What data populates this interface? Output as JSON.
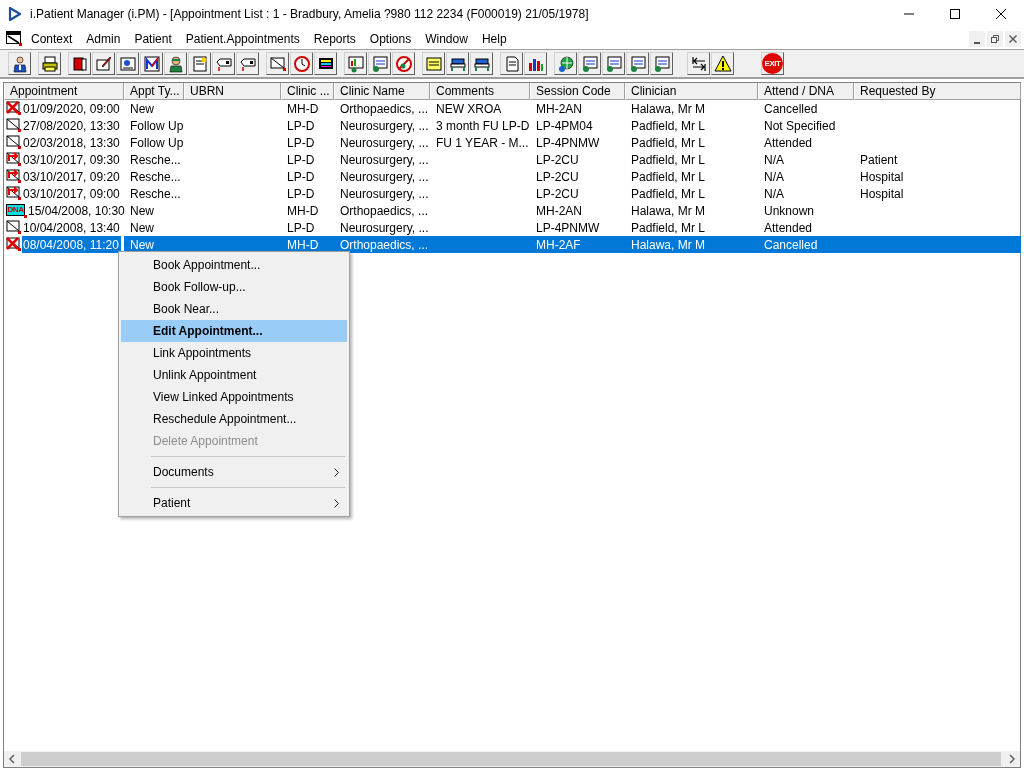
{
  "window": {
    "title": "i.Patient Manager (i.PM) - [Appointment List : 1 - Bradbury, Amelia ?980 112 2234 (F000019) 21/05/1978]"
  },
  "menu_bar": [
    "Context",
    "Admin",
    "Patient",
    "Patient.Appointments",
    "Reports",
    "Options",
    "Window",
    "Help"
  ],
  "toolbar": {
    "exit_label": "EXIT"
  },
  "table": {
    "columns": [
      "Appointment",
      "Appt Ty...",
      "UBRN",
      "Clinic ...",
      "Clinic Name",
      "Comments",
      "Session Code",
      "Clinician",
      "Attend / DNA",
      "Requested By"
    ],
    "rows": [
      {
        "kind": "cancelled",
        "selected": false,
        "cells": [
          "01/09/2020, 09:00",
          "New",
          "",
          "MH-D",
          "Orthopaedics, ...",
          "NEW XROA",
          "MH-2AN",
          "Halawa, Mr M",
          "Cancelled",
          ""
        ]
      },
      {
        "kind": "booked",
        "selected": false,
        "cells": [
          "27/08/2020, 13:30",
          "Follow Up",
          "",
          "LP-D",
          "Neurosurgery, ...",
          "3 month FU LP-D",
          "LP-4PM04",
          "Padfield, Mr L",
          "Not Specified",
          ""
        ]
      },
      {
        "kind": "booked",
        "selected": false,
        "cells": [
          "02/03/2018, 13:30",
          "Follow Up",
          "",
          "LP-D",
          "Neurosurgery, ...",
          "FU 1 YEAR - M...",
          "LP-4PNMW",
          "Padfield, Mr L",
          "Attended",
          ""
        ]
      },
      {
        "kind": "rescheduled",
        "selected": false,
        "cells": [
          "03/10/2017, 09:30",
          "Resche...",
          "",
          "LP-D",
          "Neurosurgery, ...",
          "",
          "LP-2CU",
          "Padfield, Mr L",
          "N/A",
          "Patient"
        ]
      },
      {
        "kind": "rescheduled",
        "selected": false,
        "cells": [
          "03/10/2017, 09:20",
          "Resche...",
          "",
          "LP-D",
          "Neurosurgery, ...",
          "",
          "LP-2CU",
          "Padfield, Mr L",
          "N/A",
          "Hospital"
        ]
      },
      {
        "kind": "rescheduled",
        "selected": false,
        "cells": [
          "03/10/2017, 09:00",
          "Resche...",
          "",
          "LP-D",
          "Neurosurgery, ...",
          "",
          "LP-2CU",
          "Padfield, Mr L",
          "N/A",
          "Hospital"
        ]
      },
      {
        "kind": "dna",
        "icon_label": "DNA",
        "selected": false,
        "cells": [
          "15/04/2008, 10:30",
          "New",
          "",
          "MH-D",
          "Orthopaedics, ...",
          "",
          "MH-2AN",
          "Halawa, Mr M",
          "Unknown",
          ""
        ]
      },
      {
        "kind": "booked",
        "selected": false,
        "cells": [
          "10/04/2008, 13:40",
          "New",
          "",
          "LP-D",
          "Neurosurgery, ...",
          "",
          "LP-4PNMW",
          "Padfield, Mr L",
          "Attended",
          ""
        ]
      },
      {
        "kind": "cancelled",
        "selected": true,
        "cells": [
          "08/04/2008, 11:20",
          "New",
          "",
          "MH-D",
          "Orthopaedics, ...",
          "",
          "MH-2AF",
          "Halawa, Mr M",
          "Cancelled",
          ""
        ]
      }
    ]
  },
  "context_menu": [
    {
      "kind": "item",
      "label": "Book Appointment...",
      "selected": false,
      "disabled": false
    },
    {
      "kind": "item",
      "label": "Book Follow-up...",
      "selected": false,
      "disabled": false
    },
    {
      "kind": "item",
      "label": "Book Near...",
      "selected": false,
      "disabled": false
    },
    {
      "kind": "item",
      "label": "Edit Appointment...",
      "selected": true,
      "disabled": false
    },
    {
      "kind": "item",
      "label": "Link Appointments",
      "selected": false,
      "disabled": false
    },
    {
      "kind": "item",
      "label": "Unlink Appointment",
      "selected": false,
      "disabled": false
    },
    {
      "kind": "item",
      "label": "View Linked Appointments",
      "selected": false,
      "disabled": false
    },
    {
      "kind": "item",
      "label": "Reschedule Appointment...",
      "selected": false,
      "disabled": false
    },
    {
      "kind": "item",
      "label": "Delete Appointment",
      "selected": false,
      "disabled": true
    },
    {
      "kind": "separator"
    },
    {
      "kind": "submenu",
      "label": "Documents",
      "selected": false,
      "disabled": false
    },
    {
      "kind": "separator"
    },
    {
      "kind": "submenu",
      "label": "Patient",
      "selected": false,
      "disabled": false
    }
  ]
}
